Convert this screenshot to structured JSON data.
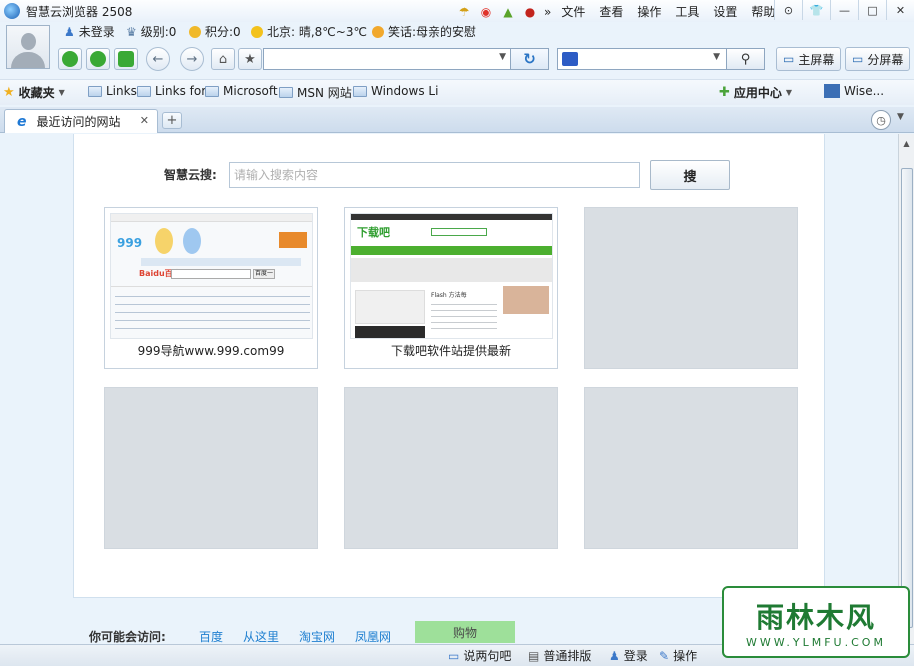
{
  "window": {
    "title": "智慧云浏览器 2508"
  },
  "menu": {
    "more": "»",
    "items": [
      "文件",
      "查看",
      "操作",
      "工具",
      "设置",
      "帮助"
    ]
  },
  "user": {
    "login": "未登录",
    "level": "级别:0",
    "points": "积分:0",
    "weather": "北京: 晴,8℃~3℃",
    "joke": "笑话:母亲的安慰"
  },
  "nav": {
    "address": {
      "value": ""
    },
    "search": {
      "value": ""
    }
  },
  "screen_buttons": {
    "main": "主屏幕",
    "split": "分屏幕"
  },
  "bookmarks": {
    "label": "收藏夹",
    "items": [
      "Links",
      "Links for",
      "Microsoft",
      "MSN 网站",
      "Windows Li"
    ],
    "app_center": "应用中心",
    "wise": "Wise..."
  },
  "tab": {
    "label": "最近访问的网站"
  },
  "search": {
    "label": "智慧云搜:",
    "placeholder": "请输入搜索内容",
    "button": "搜"
  },
  "tiles": [
    {
      "caption": "999导航www.999.com99"
    },
    {
      "caption": "下载吧软件站提供最新"
    }
  ],
  "thumb_text": {
    "nav999_logo": "999",
    "baidu": "Baidu百度",
    "baidu_btn": "百度一下",
    "xzb_logo": "下载吧",
    "flash": "Flash 方法每"
  },
  "suggest": {
    "label": "你可能会访问:",
    "links": [
      "百度",
      "从这里",
      "淘宝网",
      "凤凰网"
    ],
    "shopping": "购物"
  },
  "status": {
    "chat": "说两句吧",
    "layout": "普通排版",
    "login": "登录",
    "ops": "操作"
  },
  "watermark": {
    "brand": "雨林木风",
    "url": "WWW.YLMFU.COM"
  },
  "colors": {
    "accent": "#1e78d4",
    "link": "#1f7fd0",
    "tile_empty": "#d9dee3",
    "shopping_bg": "#9ee09a"
  }
}
